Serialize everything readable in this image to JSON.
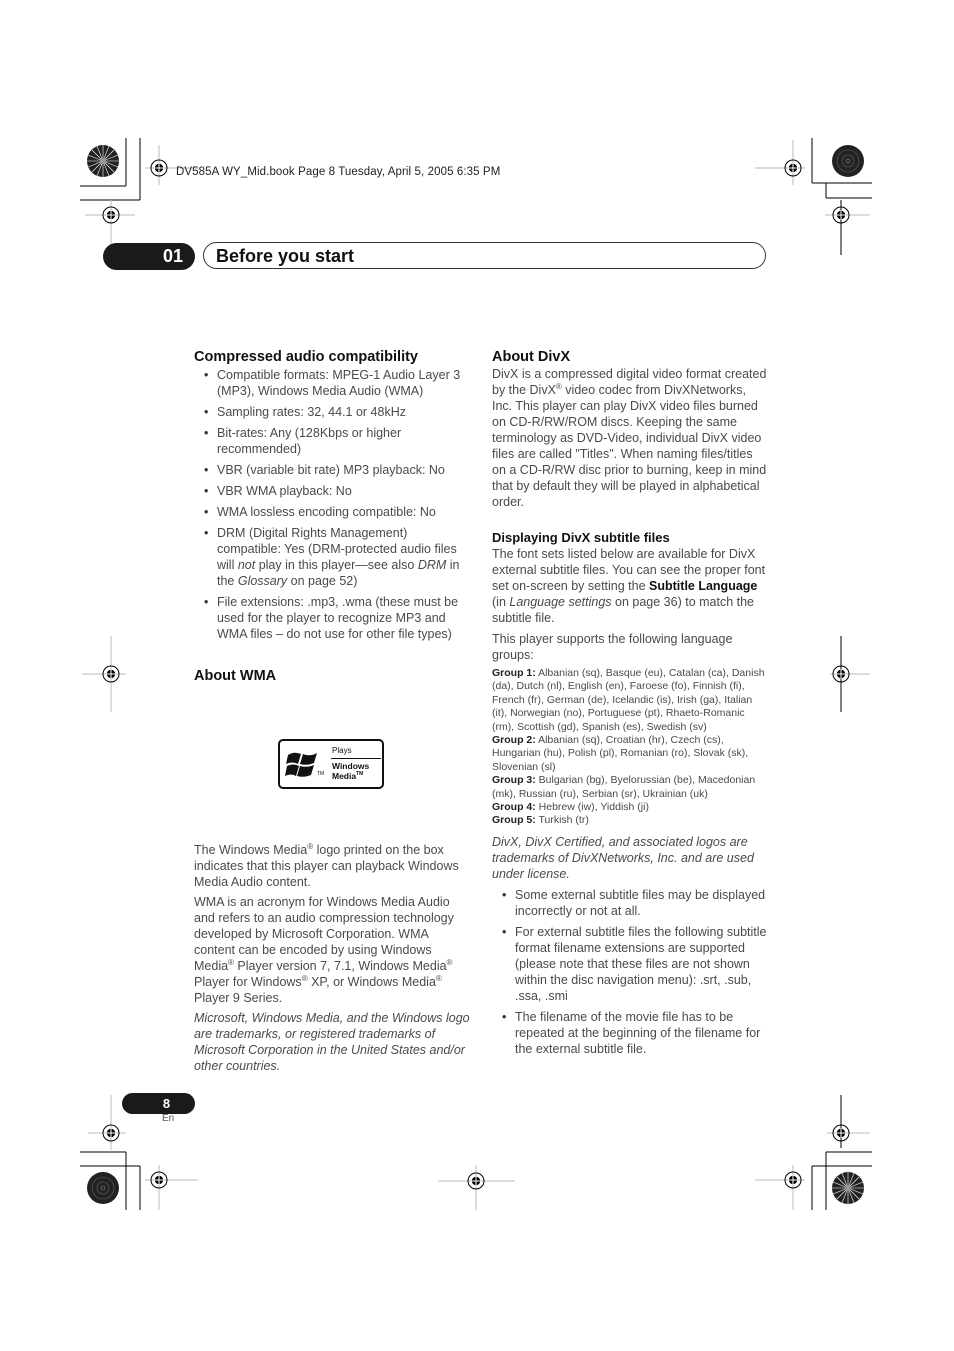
{
  "print_header": "DV585A WY_Mid.book  Page 8  Tuesday, April 5, 2005  6:35 PM",
  "chapter": {
    "number": "01",
    "title": "Before you start"
  },
  "left_column": {
    "compat": {
      "heading": "Compressed audio compatibility",
      "items": [
        "Compatible formats: MPEG-1 Audio Layer 3 (MP3), Windows Media Audio (WMA)",
        "Sampling rates: 32, 44.1 or 48kHz",
        "Bit-rates: Any (128Kbps or higher recommended)",
        "VBR (variable bit rate) MP3 playback: No",
        "VBR WMA playback: No",
        "WMA lossless encoding compatible: No"
      ],
      "drm": {
        "a": "DRM (Digital Rights Management) compatible: Yes (DRM-protected audio files will ",
        "not": "not",
        "b": " play in this player—see also ",
        "drm": "DRM",
        "c": " in the ",
        "glossary": "Glossary",
        "d": " on page 52)"
      },
      "file_ext": "File extensions: .mp3, .wma (these must be used for the player to recognize MP3 and WMA files – do not use for other file types)"
    },
    "wma": {
      "heading": "About WMA",
      "logo": {
        "plays": "Plays",
        "windows": "Windows",
        "media": "Media",
        "tm": "TM"
      },
      "p1_a": "The Windows Media",
      "reg": "®",
      "p1_b": " logo printed on the box indicates that this player can playback Windows Media Audio content.",
      "p2_a": "WMA is an acronym for Windows Media Audio and refers to an audio compression technology developed by Microsoft Corporation. WMA content can be encoded by using Windows Media",
      "p2_b": " Player version 7, 7.1, Windows Media",
      "p2_c": " Player for Windows",
      "p2_d": " XP, or Windows Media",
      "p2_e": " Player 9 Series.",
      "trademark": "Microsoft, Windows Media, and the Windows logo are trademarks, or registered trademarks of Microsoft Corporation in the United States and/or other countries."
    }
  },
  "right_column": {
    "divx": {
      "heading": "About DivX",
      "p_a": "DivX is a compressed digital video format created by the DivX",
      "reg": "®",
      "p_b": " video codec from DivXNetworks, Inc. This player can play DivX video files burned on CD-R/RW/ROM discs. Keeping the same terminology as DVD-Video, individual DivX video files are called \"Titles\". When naming files/titles on a CD-R/RW disc prior to burning, keep in mind that by default they will be played in alphabetical order."
    },
    "subtitles": {
      "heading": "Displaying DivX subtitle files",
      "p1_a": "The font sets listed below are available for DivX external subtitle files. You can see the proper font set on-screen by setting the ",
      "p1_bold": "Subtitle Language",
      "p1_b": " (in ",
      "p1_italic": "Language settings",
      "p1_c": " on page 36) to match the subtitle file.",
      "p2": "This player supports the following language groups:",
      "groups": [
        {
          "label": "Group 1:",
          "text": " Albanian (sq), Basque (eu), Catalan (ca), Danish (da), Dutch (nl), English (en), Faroese (fo), Finnish (fi), French (fr), German (de), Icelandic (is), Irish (ga), Italian (it), Norwegian (no), Portuguese (pt), Rhaeto-Romanic (rm), Scottish (gd), Spanish (es), Swedish (sv)"
        },
        {
          "label": "Group 2:",
          "text": " Albanian (sq), Croatian (hr), Czech (cs), Hungarian (hu), Polish (pl), Romanian (ro), Slovak (sk), Slovenian (sl)"
        },
        {
          "label": "Group 3:",
          "text": " Bulgarian (bg), Byelorussian (be), Macedonian (mk), Russian (ru), Serbian (sr), Ukrainian (uk)"
        },
        {
          "label": "Group 4:",
          "text": " Hebrew (iw), Yiddish (ji)"
        },
        {
          "label": "Group 5:",
          "text": " Turkish (tr)"
        }
      ],
      "trademark": "DivX, DivX Certified, and associated logos are trademarks of DivXNetworks, Inc. and are used under license.",
      "items": [
        "Some external subtitle files may be displayed incorrectly or not at all.",
        "For external subtitle files the following subtitle format filename extensions are supported (please note that these files are not shown within the disc navigation menu): .srt, .sub, .ssa, .smi",
        "The filename of the movie file has to be repeated at the beginning of the filename for the external subtitle file."
      ]
    }
  },
  "footer": {
    "page_number": "8",
    "language": "En"
  }
}
